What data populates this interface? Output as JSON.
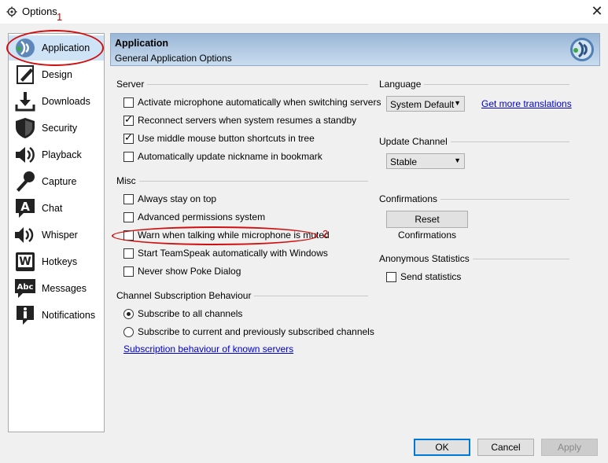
{
  "window": {
    "title": "Options",
    "close_glyph": "✕"
  },
  "sidebar": {
    "items": [
      {
        "label": "Application",
        "icon": "teamspeak-logo-icon",
        "selected": true
      },
      {
        "label": "Design",
        "icon": "pen-icon"
      },
      {
        "label": "Downloads",
        "icon": "download-icon"
      },
      {
        "label": "Security",
        "icon": "shield-icon"
      },
      {
        "label": "Playback",
        "icon": "speaker-icon"
      },
      {
        "label": "Capture",
        "icon": "microphone-icon"
      },
      {
        "label": "Chat",
        "icon": "chat-a-icon"
      },
      {
        "label": "Whisper",
        "icon": "whisper-icon"
      },
      {
        "label": "Hotkeys",
        "icon": "keyboard-w-icon"
      },
      {
        "label": "Messages",
        "icon": "abc-bubble-icon"
      },
      {
        "label": "Notifications",
        "icon": "info-icon"
      }
    ]
  },
  "header": {
    "title": "Application",
    "subtitle": "General Application Options"
  },
  "server": {
    "title": "Server",
    "options": [
      {
        "label": "Activate microphone automatically when switching servers",
        "checked": false
      },
      {
        "label": "Reconnect servers when system resumes a standby",
        "checked": true
      },
      {
        "label": "Use middle mouse button shortcuts in tree",
        "checked": true
      },
      {
        "label": "Automatically update nickname in bookmark",
        "checked": false
      }
    ]
  },
  "misc": {
    "title": "Misc",
    "options": [
      {
        "label": "Always stay on top",
        "checked": false
      },
      {
        "label": "Advanced permissions system",
        "checked": false
      },
      {
        "label": "Warn when talking while microphone is muted",
        "checked": false
      },
      {
        "label": "Start TeamSpeak automatically with Windows",
        "checked": false
      },
      {
        "label": "Never show Poke Dialog",
        "checked": false
      }
    ]
  },
  "subscription": {
    "title": "Channel Subscription Behaviour",
    "options": [
      {
        "label": "Subscribe to all channels",
        "checked": true
      },
      {
        "label": "Subscribe to current and previously subscribed channels",
        "checked": false
      }
    ],
    "link": "Subscription behaviour of known servers"
  },
  "language": {
    "title": "Language",
    "value": "System Default",
    "link": "Get more translations"
  },
  "update_channel": {
    "title": "Update Channel",
    "value": "Stable"
  },
  "confirmations": {
    "title": "Confirmations",
    "button": "Reset Confirmations"
  },
  "anonymous_stats": {
    "title": "Anonymous Statistics",
    "label": "Send statistics",
    "checked": false
  },
  "buttons": {
    "ok": "OK",
    "cancel": "Cancel",
    "apply": "Apply"
  },
  "annotations": {
    "one": "1",
    "two": "2",
    "color": "#d00000"
  }
}
